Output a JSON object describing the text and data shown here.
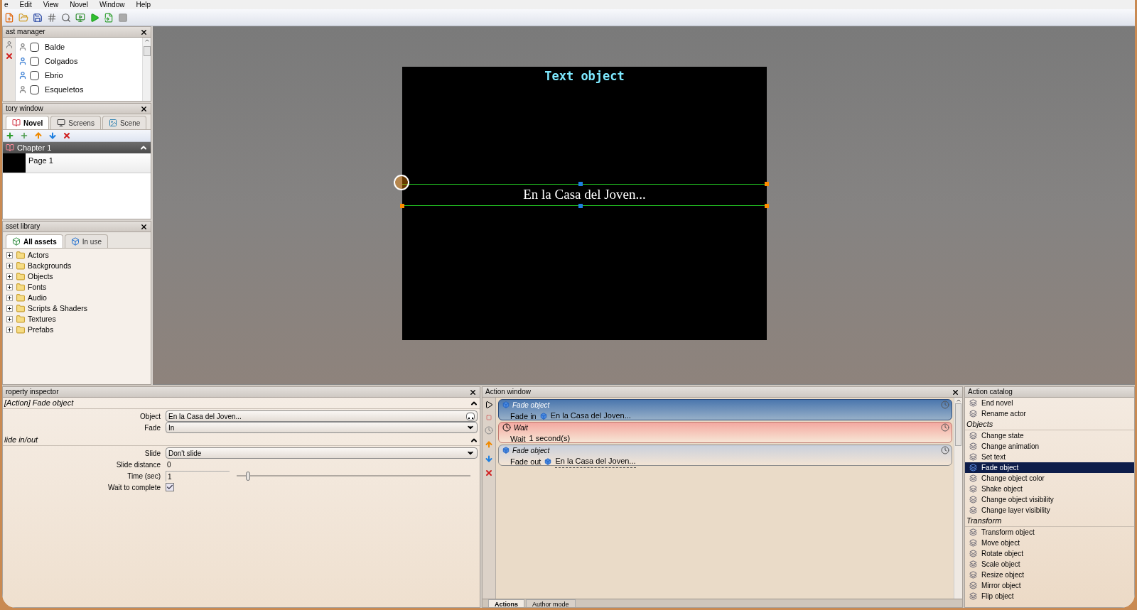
{
  "menu": [
    "e",
    "Edit",
    "View",
    "Novel",
    "Window",
    "Help"
  ],
  "cast_manager": {
    "title": "ast manager",
    "actors": [
      {
        "name": "Balde",
        "checked": false,
        "color": "#8a8a8a"
      },
      {
        "name": "Colgados",
        "checked": false,
        "color": "#3b7fd4"
      },
      {
        "name": "Ebrio",
        "checked": false,
        "color": "#3b7fd4"
      },
      {
        "name": "Esqueletos",
        "checked": false,
        "color": "#8a8a8a"
      }
    ]
  },
  "story_window": {
    "title": "tory window",
    "tabs": [
      {
        "label": "Novel",
        "selected": true
      },
      {
        "label": "Screens",
        "selected": false
      },
      {
        "label": "Scene",
        "selected": false
      }
    ],
    "chapter": {
      "title": "Chapter 1",
      "expanded": true,
      "pages": [
        "Page 1"
      ]
    }
  },
  "asset_library": {
    "title": "sset library",
    "tabs": [
      {
        "label": "All assets",
        "selected": true
      },
      {
        "label": "In use",
        "selected": false
      }
    ],
    "folders": [
      "Actors",
      "Backgrounds",
      "Objects",
      "Fonts",
      "Audio",
      "Scripts & Shaders",
      "Textures",
      "Prefabs"
    ]
  },
  "stage": {
    "title": "Text object",
    "text": "En la Casa del Joven..."
  },
  "property_inspector": {
    "title": "roperty inspector",
    "sections": [
      {
        "title": "[Action] Fade object",
        "expanded": true,
        "fields": [
          {
            "kind": "browse",
            "label": "Object",
            "value": "En la Casa del Joven..."
          },
          {
            "kind": "dropdown",
            "label": "Fade",
            "value": "In"
          }
        ]
      },
      {
        "title": "lide in/out",
        "expanded": true,
        "fields": [
          {
            "kind": "dropdown",
            "label": "Slide",
            "value": "Don't slide"
          },
          {
            "kind": "text",
            "label": "Slide distance",
            "value": "0"
          },
          {
            "kind": "slider",
            "label": "Time (sec)",
            "value": "1",
            "level": 0.05
          },
          {
            "kind": "checkbox",
            "label": "Wait to complete",
            "checked": true
          }
        ]
      }
    ]
  },
  "action_window": {
    "title": "Action window",
    "actions": [
      {
        "kind": "fade",
        "title": "Fade object",
        "verb": "Fade in",
        "target": "En la Casa del Joven...",
        "selected": true
      },
      {
        "kind": "wait",
        "title": "Wait",
        "verb": "Wait",
        "target": "1 second(s)",
        "selected": false
      },
      {
        "kind": "fade",
        "title": "Fade object",
        "verb": "Fade out",
        "target": "En la Casa del Joven...",
        "selected": false
      }
    ],
    "tabs": [
      {
        "label": "Actions",
        "selected": true
      },
      {
        "label": "Author mode",
        "selected": false
      }
    ]
  },
  "action_catalog": {
    "title": "Action catalog",
    "groups": [
      {
        "items": [
          {
            "label": "End novel",
            "selected": false
          },
          {
            "label": "Rename actor",
            "selected": false
          }
        ]
      },
      {
        "title": "Objects",
        "items": [
          {
            "label": "Change state",
            "selected": false
          },
          {
            "label": "Change animation",
            "selected": false
          },
          {
            "label": "Set text",
            "selected": false
          },
          {
            "label": "Fade object",
            "selected": true
          },
          {
            "label": "Change object color",
            "selected": false
          },
          {
            "label": "Shake object",
            "selected": false
          },
          {
            "label": "Change object visibility",
            "selected": false
          },
          {
            "label": "Change layer visibility",
            "selected": false
          }
        ]
      },
      {
        "title": "Transform",
        "items": [
          {
            "label": "Transform object",
            "selected": false
          },
          {
            "label": "Move object",
            "selected": false
          },
          {
            "label": "Rotate object",
            "selected": false
          },
          {
            "label": "Scale object",
            "selected": false
          },
          {
            "label": "Resize object",
            "selected": false
          },
          {
            "label": "Mirror object",
            "selected": false
          },
          {
            "label": "Flip object",
            "selected": false
          }
        ]
      }
    ]
  }
}
